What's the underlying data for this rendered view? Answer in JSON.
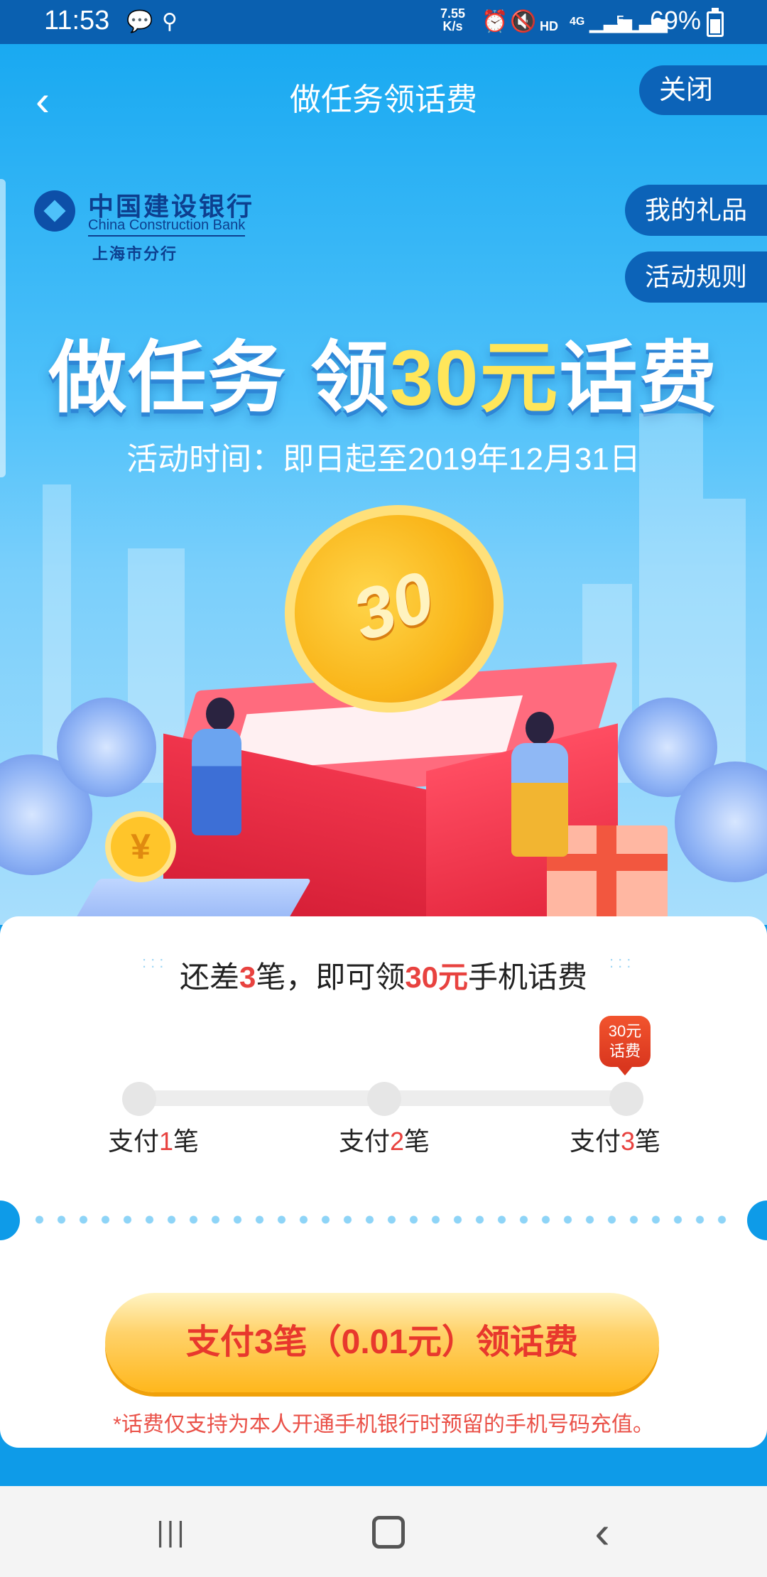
{
  "status_bar": {
    "time": "11:53",
    "net_speed_value": "7.55",
    "net_speed_unit": "K/s",
    "hd": "HD",
    "signal_4g": "4G",
    "signal_e": "E",
    "battery": "69%"
  },
  "header": {
    "back_glyph": "‹",
    "title": "做任务领话费",
    "close_label": "关闭"
  },
  "side_buttons": {
    "gifts": "我的礼品",
    "rules": "活动规则"
  },
  "logo": {
    "cn": "中国建设银行",
    "en": "China Construction Bank",
    "branch": "上海市分行"
  },
  "banner": {
    "headline_a": "做任务 领",
    "headline_accent": "30元",
    "headline_b": "话费",
    "activity_time": "活动时间：即日起至2019年12月31日",
    "coin_text": "30",
    "small_coin_text": "¥"
  },
  "progress_card": {
    "remain_prefix": "还差",
    "remain_count": "3",
    "remain_mid": "笔，即可领",
    "remain_amount": "30元",
    "remain_suffix": "手机话费",
    "reward_badge_line1": "30元",
    "reward_badge_line2": "话费",
    "steps": [
      {
        "prefix": "支付",
        "num": "1",
        "suffix": "笔"
      },
      {
        "prefix": "支付",
        "num": "2",
        "suffix": "笔"
      },
      {
        "prefix": "支付",
        "num": "3",
        "suffix": "笔"
      }
    ],
    "completed_steps": 0,
    "cta_label": "支付3笔（0.01元）领话费",
    "note": "*话费仅支持为本人开通手机银行时预留的手机号码充值。"
  },
  "colors": {
    "accent_red": "#E8423F",
    "bank_blue": "#0C63B8",
    "cta_yellow": "#FFB71C"
  },
  "navbar": {
    "recents_glyph": "|||",
    "back_glyph": "‹"
  }
}
